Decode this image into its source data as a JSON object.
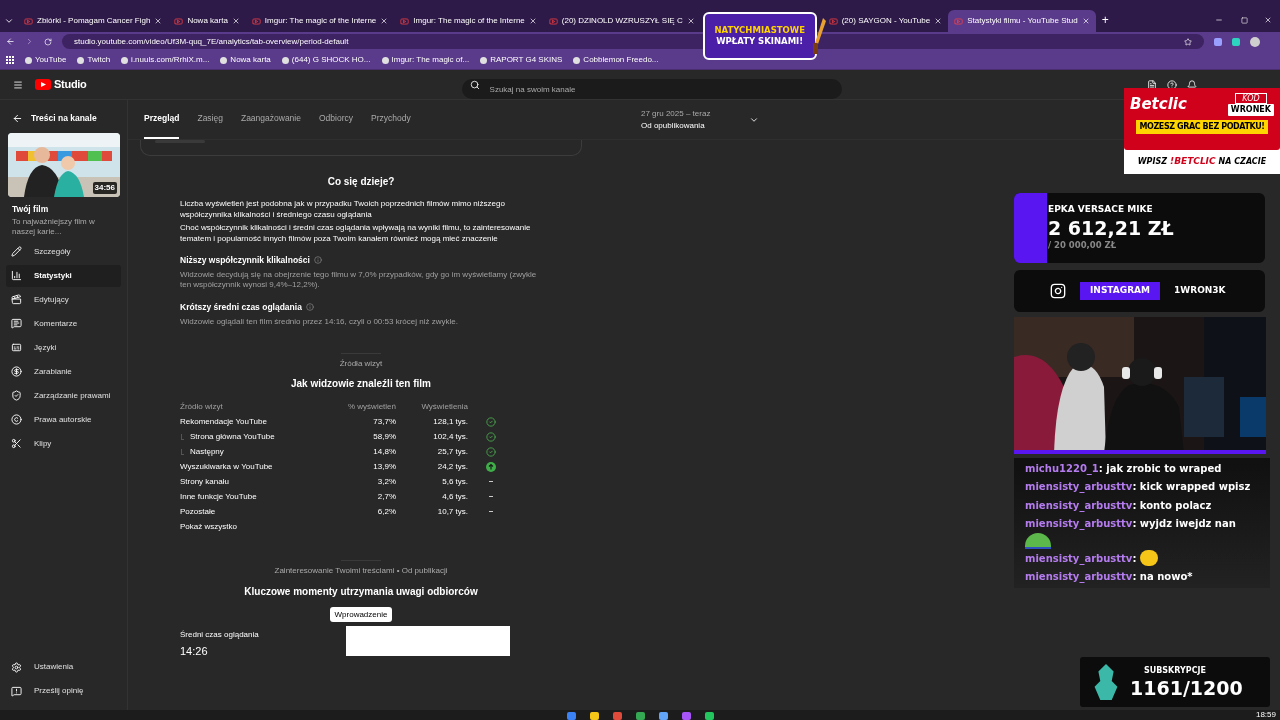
{
  "browser": {
    "tabs": [
      {
        "title": "Zbiórki - Pomagam Cancer Figh",
        "selected": false
      },
      {
        "title": "Nowa karta",
        "selected": false
      },
      {
        "title": "Imgur: The magic of the Interne",
        "selected": false
      },
      {
        "title": "Imgur: The magic of the Interne",
        "selected": false
      },
      {
        "title": "(20) DZINOLD WZRUSZYŁ SIĘ C",
        "selected": false
      },
      {
        "title": "(20) SAYGON - YouTube",
        "selected": false
      },
      {
        "title": "Statystyki filmu - YouTube Stud",
        "selected": true
      }
    ],
    "new_tab": "+",
    "url": "studio.youtube.com/video/Uf3M-quq_7E/analytics/tab-overview/period-default",
    "bookmarks": [
      "YouTube",
      "Twitch",
      "i.nuuls.com/RrhiX.m...",
      "Nowa karta",
      "(644) G SHOCK HO...",
      "Imgur: The magic of...",
      "RAPORT G4 SKINS",
      "Cobblemon Freedo..."
    ]
  },
  "header": {
    "logo": "Studio",
    "search": {
      "placeholder": "Szukaj na swoim kanale"
    }
  },
  "sidebar": {
    "back": "Treści na kanale",
    "video": {
      "duration": "34:56",
      "title": "Twój film",
      "subtitle": "To najważniejszy film w naszej karie..."
    },
    "items": [
      {
        "label": "Szczegóły",
        "selected": false
      },
      {
        "label": "Statystyki",
        "selected": true
      },
      {
        "label": "Edytujący",
        "selected": false
      },
      {
        "label": "Komentarze",
        "selected": false
      },
      {
        "label": "Języki",
        "selected": false
      },
      {
        "label": "Zarabianie",
        "selected": false
      },
      {
        "label": "Zarządzanie prawami",
        "selected": false
      },
      {
        "label": "Prawa autorskie",
        "selected": false
      },
      {
        "label": "Klipy",
        "selected": false
      }
    ],
    "bottom_items": [
      "Ustawienia",
      "Prześlij opinię"
    ]
  },
  "tabs": [
    {
      "label": "Przegląd",
      "selected": true
    },
    {
      "label": "Zasięg",
      "selected": false
    },
    {
      "label": "Zaangażowanie",
      "selected": false
    },
    {
      "label": "Odbiorcy",
      "selected": false
    },
    {
      "label": "Przychody",
      "selected": false
    }
  ],
  "period": {
    "range": "27 gru 2025 – teraz",
    "label": "Od opublikowania"
  },
  "insights": {
    "title": "Co się dzieje?",
    "paragraphs": [
      "Liczba wyświetleń jest podobna jak w przypadku Twoich poprzednich filmów mimo niższego współczynnika klikalności i średniego czasu oglądania",
      "Choć współczynnik klikalności i średni czas oglądania wpływają na wyniki filmu, to zainteresowanie tematem i popularność innych filmów poza Twoim kanałem również mogą mieć znaczenie"
    ],
    "findings": [
      {
        "title": "Niższy współczynnik klikalności",
        "text": "Widzowie decydują się na obejrzenie tego filmu w 7,0% przypadków, gdy go im wyświetlamy (zwykle ten współczynnik wynosi 9,4%–12,2%)."
      },
      {
        "title": "Krótszy średni czas oglądania",
        "text": "Widzowie oglądali ten film średnio przez 14:16, czyli o 00:53 krócej niż zwykle."
      }
    ]
  },
  "traffic": {
    "eyebrow": "Źródła wizyt",
    "title": "Jak widzowie znaleźli ten film",
    "columns": [
      "Źródło wizyt",
      "% wyświetleń",
      "Wyświetlenia"
    ],
    "rows": [
      {
        "source": "Rekomendacje YouTube",
        "share": "73,7%",
        "views": "128,1 tys.",
        "kind": "typical",
        "children": [
          {
            "source": "Strona główna YouTube",
            "share": "58,9%",
            "views": "102,4 tys.",
            "kind": "typical"
          },
          {
            "source": "Następny",
            "share": "14,8%",
            "views": "25,7 tys.",
            "kind": "typical"
          }
        ]
      },
      {
        "source": "Wyszukiwarka w YouTube",
        "share": "13,9%",
        "views": "24,2 tys.",
        "kind": "above"
      },
      {
        "source": "Strony kanału",
        "share": "3,2%",
        "views": "5,6 tys.",
        "kind": "none"
      },
      {
        "source": "Inne funkcje YouTube",
        "share": "2,7%",
        "views": "4,6 tys.",
        "kind": "none"
      },
      {
        "source": "Pozostałe",
        "share": "6,2%",
        "views": "10,7 tys.",
        "kind": "none"
      }
    ],
    "show_all": "Pokaż wszystko"
  },
  "retention": {
    "eyebrow": "Zainteresowanie Twoimi treściami • Od publikacji",
    "title": "Kluczowe momenty utrzymania uwagi odbiorców",
    "chips": [
      {
        "label": "Wprowadzenie",
        "selected": true
      }
    ],
    "metric_label": "Średni czas oglądania",
    "metric_value": "14:26"
  },
  "overlays": {
    "donation_popup": [
      "NATYCHMIASTOWE",
      "WPŁATY SKINAMI!"
    ],
    "sponsor": {
      "brand": "Betclic",
      "code_label": "KOD",
      "code": "WRONEK",
      "tagline": "MOZESZ GRAC BEZ PODATKU!",
      "cta": [
        "WPISZ",
        "!BETCLIC",
        "NA CZACIE"
      ]
    },
    "goal": {
      "title": "EPKA VERSACE MIKE",
      "amount": "2 612,21 ZŁ",
      "target": "/ 20 000,00 ZŁ",
      "level": 0.13
    },
    "social": {
      "network": "INSTAGRAM",
      "handle": "1WRON3K"
    },
    "chat": [
      {
        "user": "michu1220_1",
        "text": ": jak zrobic to wraped",
        "emote": false,
        "color": "#b57cf0"
      },
      {
        "user": "miensisty_arbusttv",
        "text": ": kick wrapped wpisz",
        "emote": false,
        "color": "#b57cf0"
      },
      {
        "user": "miensisty_arbusttv",
        "text": ": konto polacz",
        "emote": false,
        "color": "#b57cf0"
      },
      {
        "user": "miensisty_arbusttv",
        "text": ": wyjdz iwejdz nan",
        "emote": true,
        "color": "#b57cf0"
      },
      {
        "user": "miensisty_arbusttv",
        "text": ":",
        "emote": true,
        "color": "#b57cf0"
      },
      {
        "user": "miensisty_arbusttv",
        "text": ": na nowo*",
        "emote": false,
        "color": "#b57cf0"
      }
    ],
    "subs": {
      "label": "SUBSKRYPCJE",
      "count": "1161/1200"
    }
  },
  "taskbar": {
    "time": "18:59"
  }
}
